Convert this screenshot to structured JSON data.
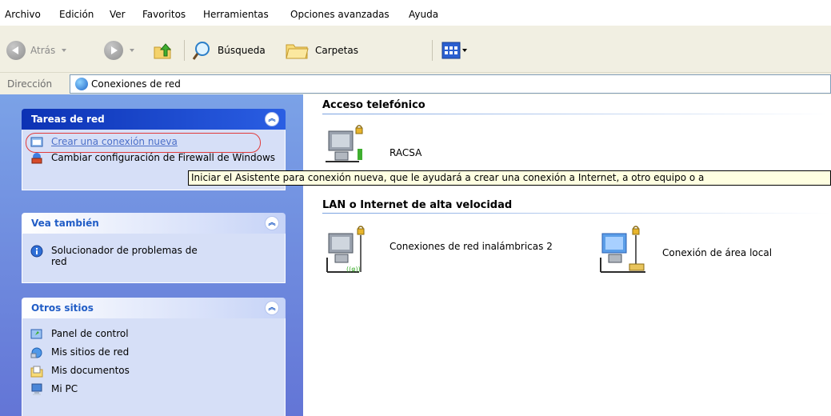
{
  "menubar": {
    "items": [
      "Archivo",
      "Edición",
      "Ver",
      "Favoritos",
      "Herramientas",
      "Opciones avanzadas",
      "Ayuda"
    ]
  },
  "toolbar": {
    "back_label": "Atrás",
    "search_label": "Búsqueda",
    "folders_label": "Carpetas"
  },
  "address": {
    "label": "Dirección",
    "value": "Conexiones de red"
  },
  "taskpane": {
    "network_tasks": {
      "title": "Tareas de red",
      "items": [
        "Crear una conexión nueva",
        "Cambiar configuración de Firewall de Windows"
      ]
    },
    "see_also": {
      "title": "Vea también",
      "items": [
        "Solucionador de problemas de red"
      ]
    },
    "other_places": {
      "title": "Otros sitios",
      "items": [
        "Panel de control",
        "Mis sitios de red",
        "Mis documentos",
        "Mi PC"
      ]
    }
  },
  "content": {
    "dialup": {
      "title": "Acceso telefónico",
      "items": [
        "RACSA"
      ]
    },
    "lan": {
      "title": "LAN o Internet de alta velocidad",
      "items": [
        "Conexiones de red inalámbricas 2",
        "Conexión de área local"
      ]
    }
  },
  "tooltip": "Iniciar el Asistente para conexión nueva, que le ayudará a crear una conexión a Internet, a otro equipo o a",
  "colors": {
    "taskpane_bg": "#7ba2e7",
    "panel_body": "#d6dff7",
    "link_blue": "#215dc6",
    "toolbar_bg": "#f1efe2",
    "highlight_red": "#e23a3a",
    "tooltip_bg": "#ffffe1"
  }
}
